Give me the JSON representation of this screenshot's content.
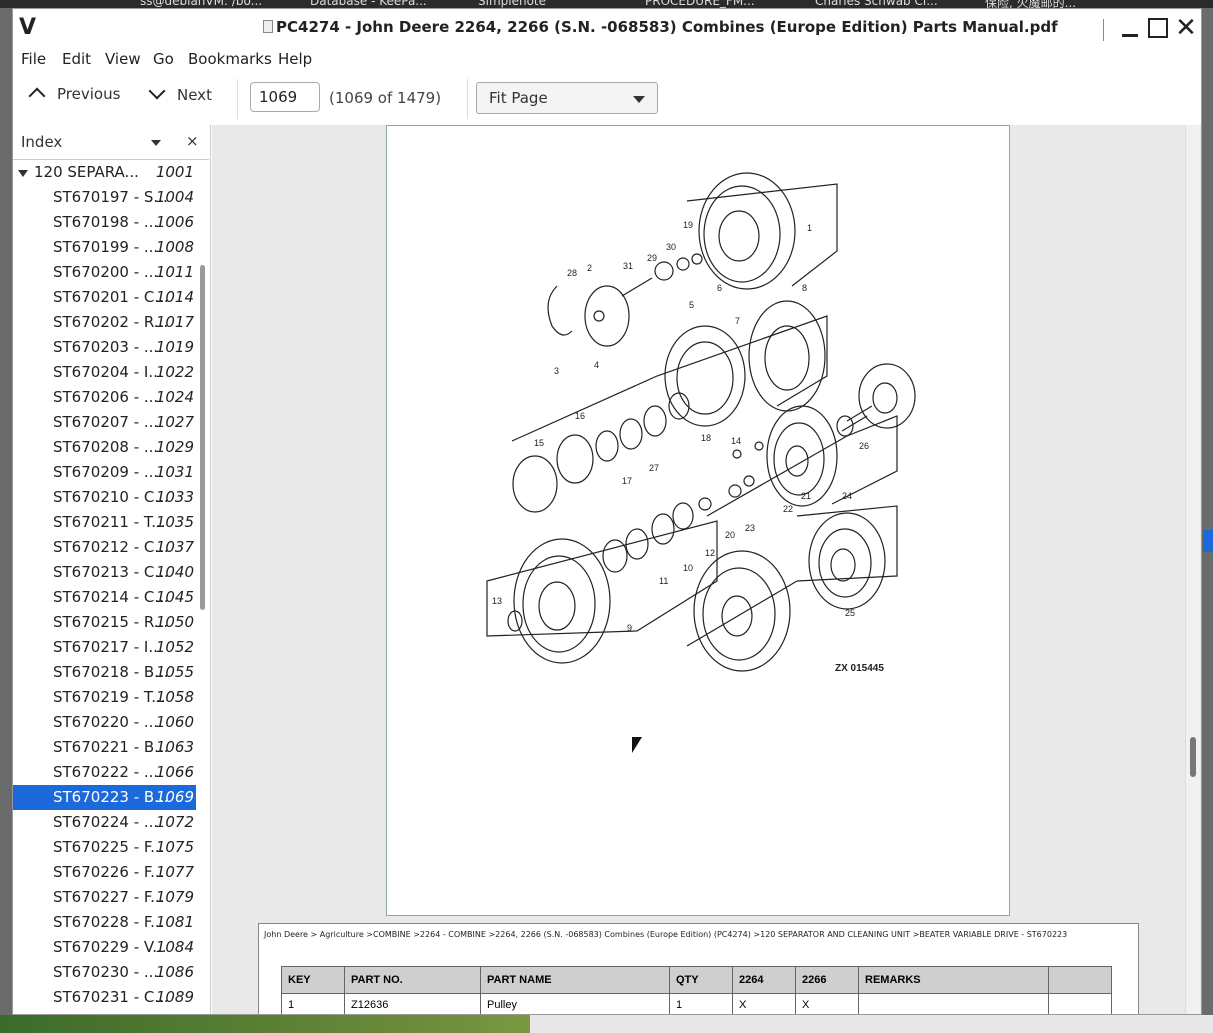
{
  "top_strip": [
    "ss@debianVM: /bo...",
    "Database - KeePa...",
    "Simplenote",
    "PROCEDURE_FM...",
    "Charles Schwab Cl...",
    "保险, 火魔邮的..."
  ],
  "window": {
    "app_logo": "V",
    "title": "PC4274 - John Deere 2264, 2266 (S.N. -068583) Combines (Europe Edition) Parts Manual.pdf"
  },
  "menu": [
    "File",
    "Edit",
    "View",
    "Go",
    "Bookmarks",
    "Help"
  ],
  "toolbar": {
    "previous_label": "Previous",
    "next_label": "Next",
    "page_value": "1069",
    "page_count": "(1069 of 1479)",
    "zoom_value": "Fit Page"
  },
  "sidebar": {
    "header": "Index",
    "close_glyph": "×",
    "items": [
      {
        "label": "120 SEPARA...",
        "page": "1001",
        "level": 0
      },
      {
        "label": "ST670197 - S...",
        "page": "1004",
        "level": 1
      },
      {
        "label": "ST670198 - ...",
        "page": "1006",
        "level": 1
      },
      {
        "label": "ST670199 - ...",
        "page": "1008",
        "level": 1
      },
      {
        "label": "ST670200 - ...",
        "page": "1011",
        "level": 1
      },
      {
        "label": "ST670201 - C...",
        "page": "1014",
        "level": 1
      },
      {
        "label": "ST670202 - R...",
        "page": "1017",
        "level": 1
      },
      {
        "label": "ST670203 - ...",
        "page": "1019",
        "level": 1
      },
      {
        "label": "ST670204 - I...",
        "page": "1022",
        "level": 1
      },
      {
        "label": "ST670206 - ...",
        "page": "1024",
        "level": 1
      },
      {
        "label": "ST670207 - ...",
        "page": "1027",
        "level": 1
      },
      {
        "label": "ST670208 - ...",
        "page": "1029",
        "level": 1
      },
      {
        "label": "ST670209 - ...",
        "page": "1031",
        "level": 1
      },
      {
        "label": "ST670210 - C...",
        "page": "1033",
        "level": 1
      },
      {
        "label": "ST670211 - T...",
        "page": "1035",
        "level": 1
      },
      {
        "label": "ST670212 - C...",
        "page": "1037",
        "level": 1
      },
      {
        "label": "ST670213 - C...",
        "page": "1040",
        "level": 1
      },
      {
        "label": "ST670214 - C...",
        "page": "1045",
        "level": 1
      },
      {
        "label": "ST670215 - R...",
        "page": "1050",
        "level": 1
      },
      {
        "label": "ST670217 - I...",
        "page": "1052",
        "level": 1
      },
      {
        "label": "ST670218 - B...",
        "page": "1055",
        "level": 1
      },
      {
        "label": "ST670219 - T...",
        "page": "1058",
        "level": 1
      },
      {
        "label": "ST670220 - ...",
        "page": "1060",
        "level": 1
      },
      {
        "label": "ST670221 - B...",
        "page": "1063",
        "level": 1
      },
      {
        "label": "ST670222 - ...",
        "page": "1066",
        "level": 1
      },
      {
        "label": "ST670223 - B...",
        "page": "1069",
        "level": 1,
        "selected": true
      },
      {
        "label": "ST670224 - ...",
        "page": "1072",
        "level": 1
      },
      {
        "label": "ST670225 - F...",
        "page": "1075",
        "level": 1
      },
      {
        "label": "ST670226 - F...",
        "page": "1077",
        "level": 1
      },
      {
        "label": "ST670227 - F...",
        "page": "1079",
        "level": 1
      },
      {
        "label": "ST670228 - F...",
        "page": "1081",
        "level": 1
      },
      {
        "label": "ST670229 - V...",
        "page": "1084",
        "level": 1
      },
      {
        "label": "ST670230 - ...",
        "page": "1086",
        "level": 1
      },
      {
        "label": "ST670231 - C...",
        "page": "1089",
        "level": 1
      }
    ]
  },
  "drawing": {
    "figure_id": "ZX 015445",
    "callouts": [
      "1",
      "2",
      "3",
      "4",
      "5",
      "6",
      "7",
      "8",
      "9",
      "10",
      "11",
      "12",
      "13",
      "14",
      "15",
      "16",
      "17",
      "18",
      "19",
      "20",
      "21",
      "22",
      "23",
      "24",
      "25",
      "26",
      "27",
      "28",
      "29",
      "30",
      "31"
    ]
  },
  "parts_page": {
    "breadcrumb": "John Deere > Agriculture >COMBINE >2264 - COMBINE >2264, 2266 (S.N. -068583) Combines (Europe Edition) (PC4274) >120 SEPARATOR AND CLEANING UNIT >BEATER VARIABLE DRIVE - ST670223",
    "columns": [
      "KEY",
      "PART NO.",
      "PART NAME",
      "QTY",
      "2264",
      "2266",
      "REMARKS",
      ""
    ],
    "rows": [
      [
        "1",
        "Z12636",
        "Pulley",
        "1",
        "X",
        "X",
        "",
        ""
      ]
    ]
  }
}
